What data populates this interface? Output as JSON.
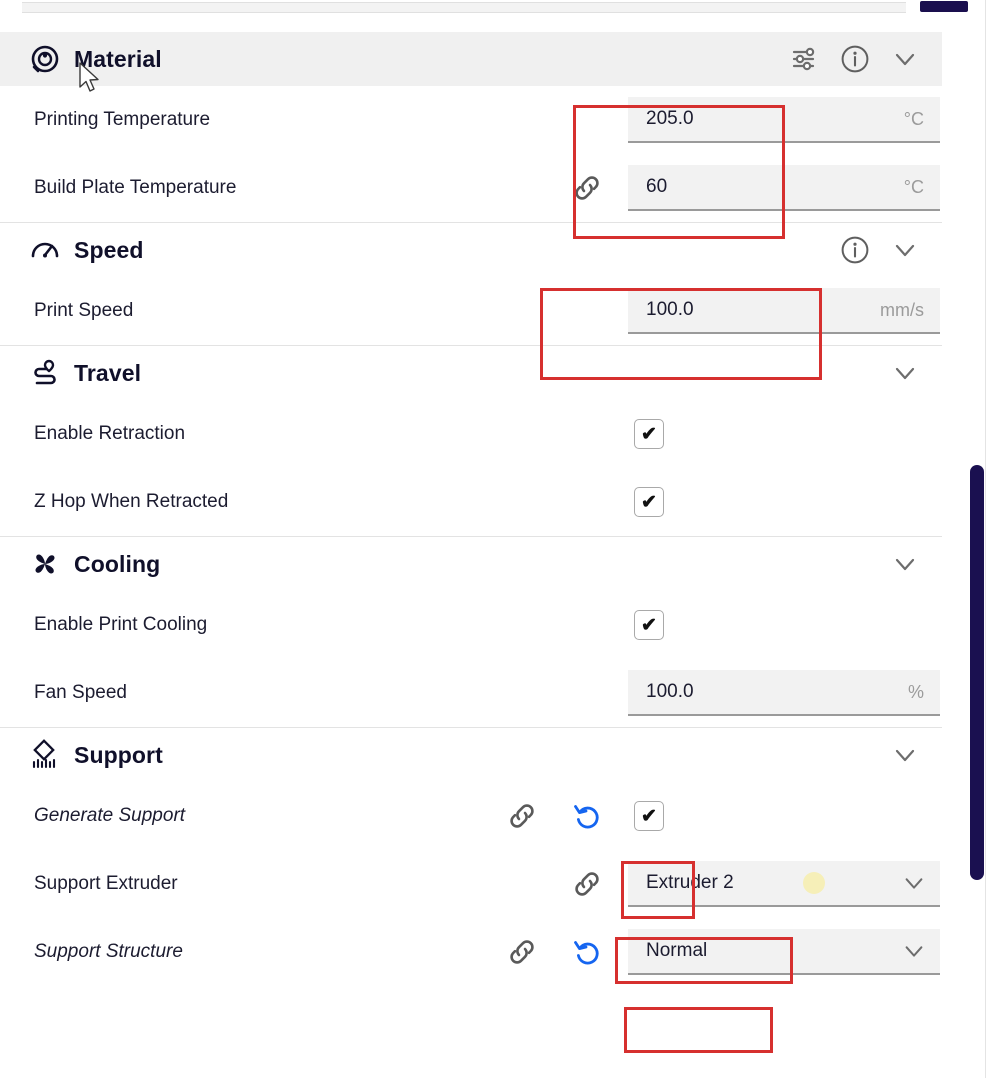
{
  "app": {
    "name": "cura-print-settings-panel",
    "accent_navy": "#1a1050",
    "highlight_red": "#d6302f",
    "revert_blue": "#1565f0",
    "extruder_swatch": "#f6efb8"
  },
  "sections": [
    {
      "id": "material",
      "title": "Material",
      "icon": "material-spool-icon",
      "header_shaded": true,
      "header_icons": [
        "sliders-settings-icon",
        "info-icon",
        "chevron-down-icon"
      ],
      "rows": [
        {
          "label": "Printing Temperature",
          "italic": false,
          "control": "field",
          "value": "205.0",
          "unit": "°C",
          "link": false,
          "revert": false,
          "highlighted": true
        },
        {
          "label": "Build Plate Temperature",
          "italic": false,
          "control": "field",
          "value": "60",
          "unit": "°C",
          "link": true,
          "revert": false,
          "highlighted": true
        }
      ]
    },
    {
      "id": "speed",
      "title": "Speed",
      "icon": "speedometer-icon",
      "header_shaded": false,
      "header_icons": [
        "info-icon",
        "chevron-down-icon"
      ],
      "rows": [
        {
          "label": "Print Speed",
          "italic": false,
          "control": "field",
          "value": "100.0",
          "unit": "mm/s",
          "link": false,
          "revert": false,
          "highlighted": true
        }
      ]
    },
    {
      "id": "travel",
      "title": "Travel",
      "icon": "travel-route-icon",
      "header_shaded": false,
      "header_icons": [
        "chevron-down-icon"
      ],
      "rows": [
        {
          "label": "Enable Retraction",
          "italic": false,
          "control": "checkbox",
          "checked": true,
          "link": false,
          "revert": false,
          "highlighted": false
        },
        {
          "label": "Z Hop When Retracted",
          "italic": false,
          "control": "checkbox",
          "checked": true,
          "link": false,
          "revert": false,
          "highlighted": false
        }
      ]
    },
    {
      "id": "cooling",
      "title": "Cooling",
      "icon": "fan-cooling-icon",
      "header_shaded": false,
      "header_icons": [
        "chevron-down-icon"
      ],
      "rows": [
        {
          "label": "Enable Print Cooling",
          "italic": false,
          "control": "checkbox",
          "checked": true,
          "link": false,
          "revert": false,
          "highlighted": false
        },
        {
          "label": "Fan Speed",
          "italic": false,
          "control": "field",
          "value": "100.0",
          "unit": "%",
          "link": false,
          "revert": false,
          "highlighted": false
        }
      ]
    },
    {
      "id": "support",
      "title": "Support",
      "icon": "support-structure-icon",
      "header_shaded": false,
      "header_icons": [
        "chevron-down-icon"
      ],
      "rows": [
        {
          "label": "Generate Support",
          "italic": true,
          "control": "checkbox",
          "checked": true,
          "link": true,
          "revert": true,
          "highlighted": true
        },
        {
          "label": "Support Extruder",
          "italic": false,
          "control": "dropdown",
          "value": "Extruder 2",
          "swatch": true,
          "link": true,
          "revert": false,
          "highlighted": true
        },
        {
          "label": "Support Structure",
          "italic": true,
          "control": "dropdown",
          "value": "Normal",
          "swatch": false,
          "link": true,
          "revert": true,
          "highlighted": true
        }
      ]
    }
  ],
  "scrollbars": {
    "vertical_thumb_color": "#1a1050",
    "horizontal_thumb_color": "#1a0f4e"
  }
}
